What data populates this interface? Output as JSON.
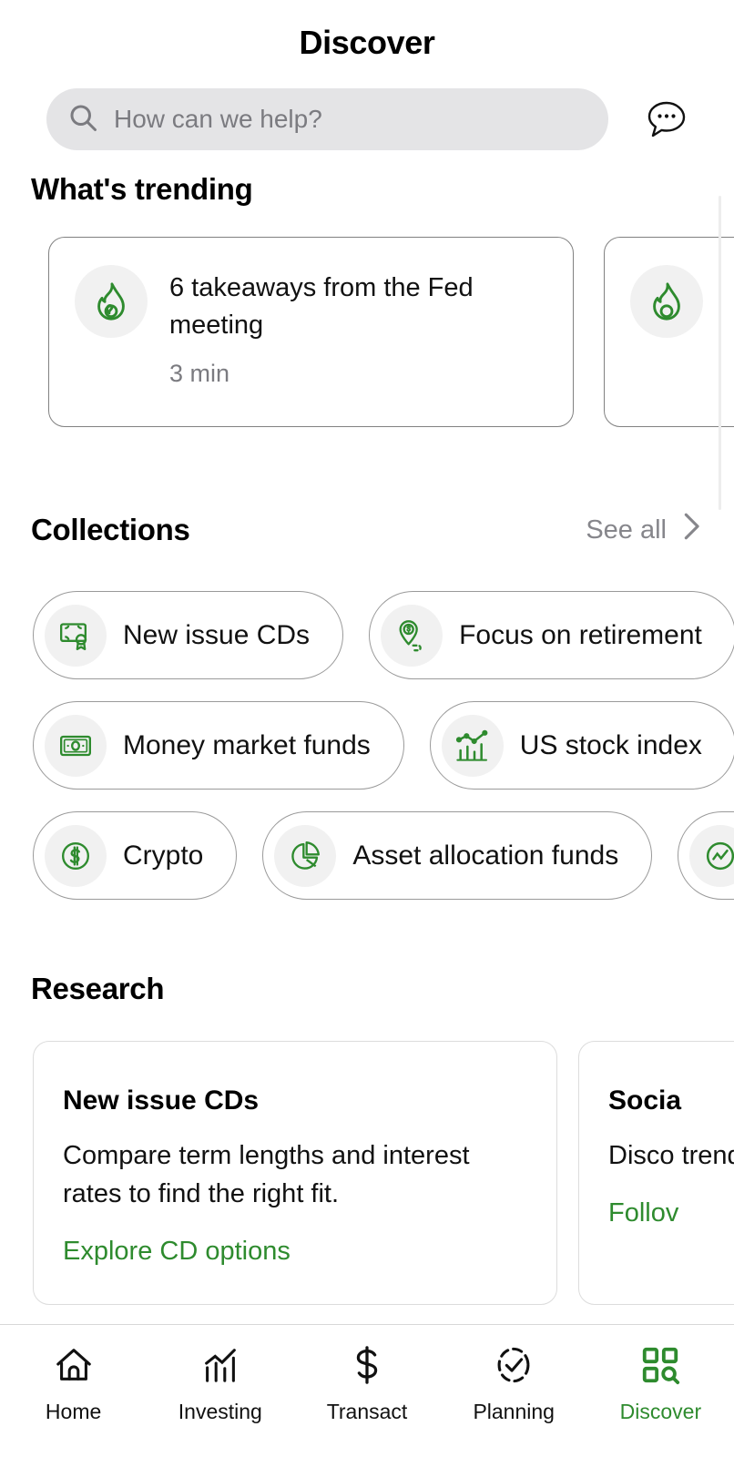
{
  "header": {
    "title": "Discover",
    "search_placeholder": "How can we help?",
    "search_value": "",
    "search_icon": "search-icon",
    "chat_icon": "chat-bubble-icon"
  },
  "trending": {
    "heading": "What's trending",
    "cards": [
      {
        "icon": "flame-icon",
        "title": "6 takeaways from the Fed meeting",
        "meta": "3 min"
      },
      {
        "icon": "flame-icon",
        "title": "",
        "meta": ""
      }
    ]
  },
  "collections": {
    "heading": "Collections",
    "see_all": "See all",
    "see_all_icon": "chevron-right-icon",
    "rows": [
      [
        {
          "icon": "certificate-icon",
          "label": "New issue CDs"
        },
        {
          "icon": "pin-dollar-icon",
          "label": "Focus on retirement"
        }
      ],
      [
        {
          "icon": "banknote-icon",
          "label": "Money market funds"
        },
        {
          "icon": "bar-line-chart-icon",
          "label": "US stock index"
        }
      ],
      [
        {
          "icon": "crypto-coin-icon",
          "label": "Crypto"
        },
        {
          "icon": "pie-chart-icon",
          "label": "Asset allocation funds"
        },
        {
          "icon": "line-chart-circle-icon",
          "label": ""
        }
      ]
    ]
  },
  "research": {
    "heading": "Research",
    "cards": [
      {
        "title": "New issue CDs",
        "body": "Compare term lengths and interest rates to find the right fit.",
        "link": "Explore CD options"
      },
      {
        "title": "Socia",
        "body": "Disco trendi",
        "link": "Follov"
      }
    ]
  },
  "tabbar": {
    "tabs": [
      {
        "icon": "home-icon",
        "label": "Home",
        "active": false
      },
      {
        "icon": "investing-chart-icon",
        "label": "Investing",
        "active": false
      },
      {
        "icon": "dollar-sign-icon",
        "label": "Transact",
        "active": false
      },
      {
        "icon": "planning-check-icon",
        "label": "Planning",
        "active": false
      },
      {
        "icon": "discover-grid-search-icon",
        "label": "Discover",
        "active": true
      }
    ]
  },
  "colors": {
    "brand_green": "#2E8B2E",
    "text_primary": "#111111",
    "text_muted": "#7B7B80",
    "search_bg": "#E4E4E6",
    "icon_bg": "#F1F1F1"
  }
}
